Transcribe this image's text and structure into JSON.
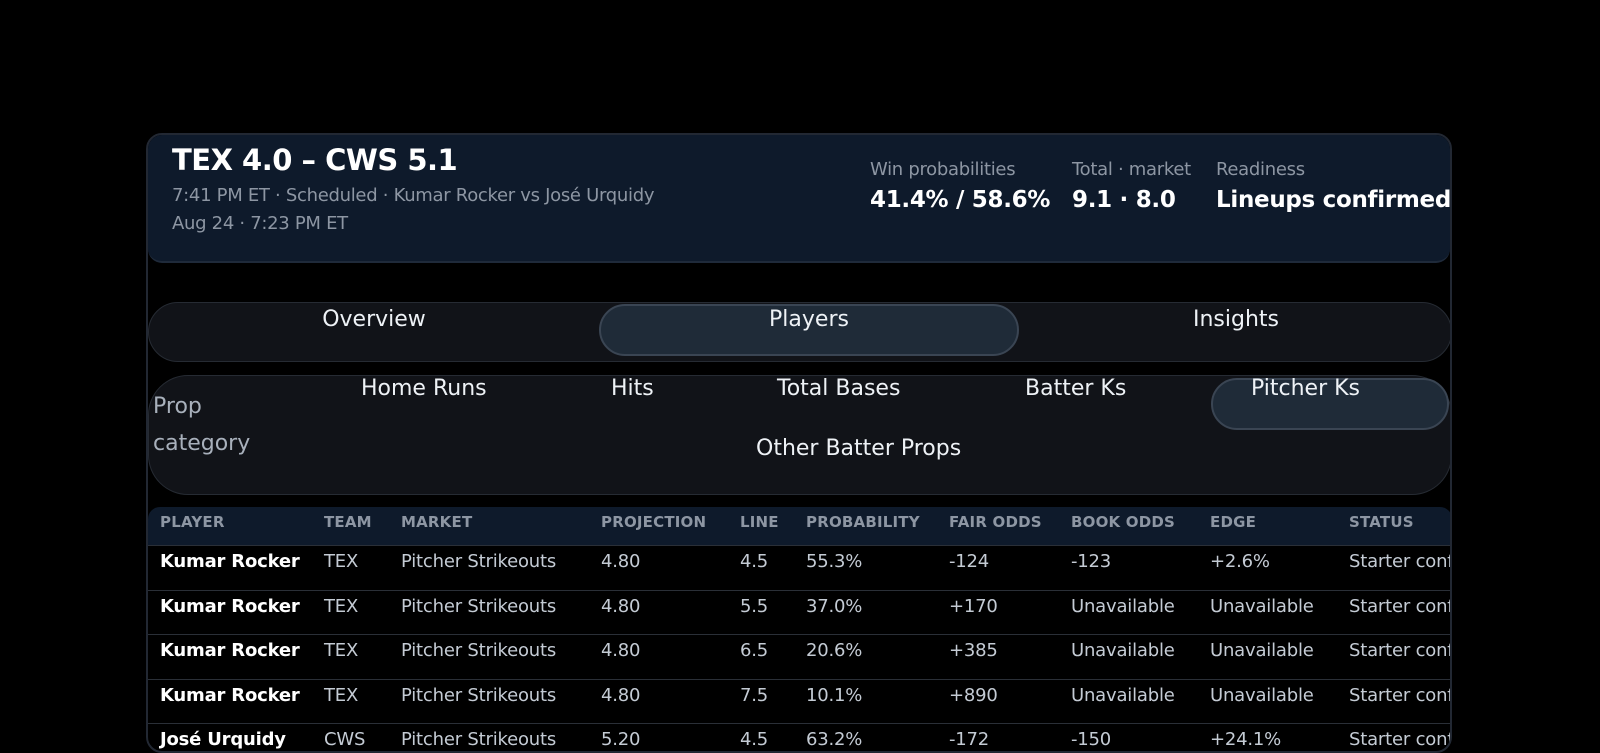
{
  "header": {
    "score": "TEX 4.0 – CWS 5.1",
    "status_line": "7:41 PM ET · Scheduled · Kumar Rocker vs José Urquidy",
    "date_line": "Aug 24 · 7:23 PM ET",
    "stats": [
      {
        "label": "Win probabilities",
        "value": "41.4% / 58.6%"
      },
      {
        "label": "Total · market",
        "value": "9.1 · 8.0"
      },
      {
        "label": "Readiness",
        "value": "Lineups confirmed"
      }
    ]
  },
  "tabs": [
    {
      "label": "Overview",
      "active": false
    },
    {
      "label": "Players",
      "active": true
    },
    {
      "label": "Insights",
      "active": false
    }
  ],
  "prop_category": {
    "label": "Prop category",
    "options": [
      {
        "label": "Home Runs",
        "active": false
      },
      {
        "label": "Hits",
        "active": false
      },
      {
        "label": "Total Bases",
        "active": false
      },
      {
        "label": "Batter Ks",
        "active": false
      },
      {
        "label": "Pitcher Ks",
        "active": true
      },
      {
        "label": "Other Batter Props",
        "active": false
      }
    ]
  },
  "table": {
    "columns": [
      "PLAYER",
      "TEAM",
      "MARKET",
      "PROJECTION",
      "LINE",
      "PROBABILITY",
      "FAIR ODDS",
      "BOOK ODDS",
      "EDGE",
      "STATUS"
    ],
    "rows": [
      [
        "Kumar Rocker",
        "TEX",
        "Pitcher Strikeouts",
        "4.80",
        "4.5",
        "55.3%",
        "-124",
        "-123",
        "+2.6%",
        "Starter confirmed"
      ],
      [
        "Kumar Rocker",
        "TEX",
        "Pitcher Strikeouts",
        "4.80",
        "5.5",
        "37.0%",
        "+170",
        "Unavailable",
        "Unavailable",
        "Starter confirmed"
      ],
      [
        "Kumar Rocker",
        "TEX",
        "Pitcher Strikeouts",
        "4.80",
        "6.5",
        "20.6%",
        "+385",
        "Unavailable",
        "Unavailable",
        "Starter confirmed"
      ],
      [
        "Kumar Rocker",
        "TEX",
        "Pitcher Strikeouts",
        "4.80",
        "7.5",
        "10.1%",
        "+890",
        "Unavailable",
        "Unavailable",
        "Starter confirmed"
      ],
      [
        "José Urquidy",
        "CWS",
        "Pitcher Strikeouts",
        "5.20",
        "4.5",
        "63.2%",
        "-172",
        "-150",
        "+24.1%",
        "Starter confirmed"
      ]
    ]
  },
  "colors": {
    "background": "#000000",
    "header_bg": "#0e1a2b",
    "panel_bg": "#111318",
    "active_bg": "#1f2b38",
    "muted_text": "#8d96a3"
  }
}
